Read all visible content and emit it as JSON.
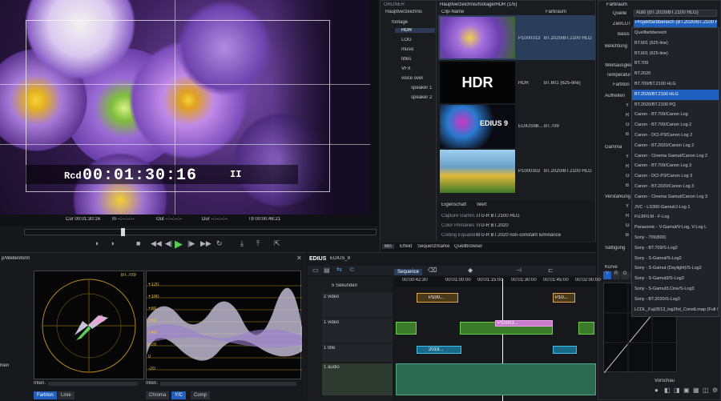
{
  "preview": {
    "timecode": "00:01:30:16",
    "rec_label": "Rcd",
    "pause_glyph": "II",
    "cur": "Cur 00:01:30:16",
    "in": "In --:--:--:--",
    "out": "Out --:--:--:--",
    "dur": "Dur --:--:--:--",
    "ttl": "Ttl 00:00:48:21"
  },
  "bin": {
    "header": "ORDNER",
    "path": "Hauptverzeichnis/footage/HDR (1/5)",
    "tree": [
      "Hauptverzeichnis",
      "footage",
      "HDR",
      "LOG",
      "music",
      "titles",
      "VFX",
      "voice over",
      "speaker 1",
      "speaker 2"
    ],
    "columns": [
      "Clip-Name",
      "Farbraum"
    ],
    "clips": [
      {
        "name": "P1000313",
        "space": "BT.2020/BT.2100 HLG"
      },
      {
        "name": "HDR",
        "space": "BT.601 (625-line)"
      },
      {
        "name": "EDIUS9B...",
        "space": "BT.709"
      },
      {
        "name": "P1000302",
        "space": "BT.2020/BT.2100 HLG"
      }
    ],
    "hdr_thumb_text": "HDR",
    "edius_thumb_text": "EDIUS 9",
    "props_cols": [
      "Eigenschaft",
      "Wert"
    ],
    "props": [
      {
        "k": "Capture Gamm...",
        "v": "ITU-R BT.2100 HLG"
      },
      {
        "k": "Color Primaries",
        "v": "ITU-R BT.2020"
      },
      {
        "k": "Coding Equations",
        "v": "ITU-R BT.2020 non-constant luminance"
      }
    ],
    "tabs": [
      "Bin",
      "Effekt",
      "Sequenzmarke",
      "Quellbrowser"
    ]
  },
  "farbraum": {
    "title": "Farbraum",
    "rows": [
      {
        "label": "Quelle",
        "value": "Auto (BT.2020/BT.2100 HLG)"
      },
      {
        "label": "Ziel/LUT",
        "value": "Projektfarbbereich (BT.2020/BT.2100 HLG)"
      },
      {
        "label": "Basis",
        "value": "Quellfarbbereich"
      }
    ],
    "sections": [
      "Belichtung",
      "Weißausgleich",
      "Temperatur",
      "Farbton",
      "Aufhellen",
      "Y",
      "R",
      "G",
      "B",
      "Gamma",
      "Y",
      "R",
      "G",
      "B",
      "Verstärkung",
      "Y",
      "R",
      "G",
      "B",
      "Sättigung",
      "Kurve"
    ],
    "dropdown": [
      "Quellfarbbereich",
      "BT.601 (525-line)",
      "BT.601 (625-line)",
      "BT.709",
      "BT.2020",
      "BT.709/BT.2100 HLG",
      "BT.2020/BT.2100 HLG",
      "BT.2020/BT.2100 PQ",
      "Canon - BT.709/Canon Log",
      "Canon - BT.709/Canon Log 2",
      "Canon - DCI-P3/Canon Log 2",
      "Canon - BT.2020/Canon Log 2",
      "Canon - Cinema Gamut/Canon Log 2",
      "Canon - BT.709/Canon Log 3",
      "Canon - DCI-P3/Canon Log 3",
      "Canon - BT.2020/Canon Log 3",
      "Canon - Cinema Gamut/Canon Log 3",
      "JVC - LS300-Gamut/J-Log 1",
      "FUJIFILM - F-Log",
      "Panasonic - V-Gamut/V-Log, V-Log L",
      "Sony - 709(800)",
      "Sony - BT.709/S-Log2",
      "Sony - S-Gamut/S-Log2",
      "Sony - S-Gamut (Daylight)/S-Log2",
      "Sony - S-Gamut3/S-Log3",
      "Sony - S-Gamut3.Cine/S-Log3",
      "Sony - BT.2020/S-Log3",
      "LCDL_Fuji3513_log2hd_ConstLmap (Full / Full)"
    ],
    "selected_index": 6,
    "curve_channels": [
      "Y",
      "R",
      "G",
      "B"
    ],
    "vorschau": "Vorschau"
  },
  "scopes": {
    "title": "p/Wellenform",
    "vector_label": "BT.709",
    "wave_labels": [
      "+120",
      "+100",
      "+80",
      "+60",
      "+40",
      "+20",
      "0",
      "-20"
    ],
    "left_tabs": [
      "Farbton",
      "Linie"
    ],
    "right_tabs": [
      "Chroma",
      "Y/C",
      "Comp"
    ],
    "inten": "Inten.",
    "zhlen": "hlen"
  },
  "timeline": {
    "app": "EDIUS",
    "seq_tab": "EDIUS_9",
    "sequence": "Sequence",
    "zoom": "5 Sekunden",
    "ruler": [
      "00:00:42:30",
      "00:01:00:00",
      "00:01:15:00",
      "00:01:30:00",
      "00:01:45:00",
      "00:02:00:00"
    ],
    "tracks": [
      {
        "id": "2 video"
      },
      {
        "id": "1 video"
      },
      {
        "id": "1 title"
      },
      {
        "id": "1 audio"
      }
    ],
    "clip_labels": [
      "P100...",
      "P10...",
      "P10003...",
      "2019..."
    ]
  },
  "colors": {
    "accent": "#1f5fbf",
    "timecode": "#ffffff",
    "clip": "#e3a64a"
  }
}
